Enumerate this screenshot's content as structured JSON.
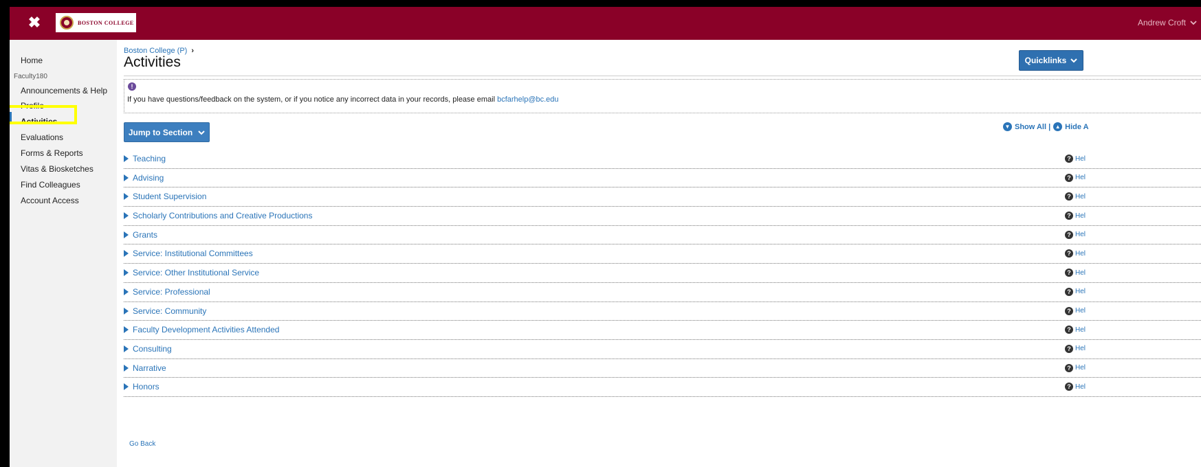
{
  "header": {
    "close_glyph": "✖",
    "logo_text": "BOSTON COLLEGE",
    "user_name": "Andrew Croft",
    "user_chevron": "⌄"
  },
  "sidebar": {
    "section_label": "Faculty180",
    "items": [
      {
        "label": "Home"
      },
      {
        "label": "Announcements & Help"
      },
      {
        "label": "Profile"
      },
      {
        "label": "Activities"
      },
      {
        "label": "Evaluations"
      },
      {
        "label": "Forms & Reports"
      },
      {
        "label": "Vitas & Biosketches"
      },
      {
        "label": "Find Colleagues"
      },
      {
        "label": "Account Access"
      }
    ],
    "active_item": "Activities",
    "highlight_color": "#ffff00"
  },
  "main": {
    "breadcrumb": "Boston College (P)",
    "breadcrumb_chevron": "›",
    "title": "Activities",
    "quicklinks_label": "Quicklinks",
    "notice": {
      "icon_glyph": "!",
      "text": "If you have questions/feedback on the system, or if you notice any incorrect data in your records, please email ",
      "email": "bcfarhelp@bc.edu"
    },
    "jump_label": "Jump to Section",
    "show_all": "Show All |",
    "hide_all": "Hide A",
    "sections": [
      "Teaching",
      "Advising",
      "Student Supervision",
      "Scholarly Contributions and Creative Productions",
      "Grants",
      "Service: Institutional Committees",
      "Service: Other Institutional Service",
      "Service: Professional",
      "Service: Community",
      "Faculty Development Activities Attended",
      "Consulting",
      "Narrative",
      "Honors"
    ],
    "help_label": "Hel",
    "go_back": "Go Back"
  },
  "colors": {
    "brand": "#8a0128",
    "link": "#2a74b8",
    "button": "#3d7fbf"
  }
}
